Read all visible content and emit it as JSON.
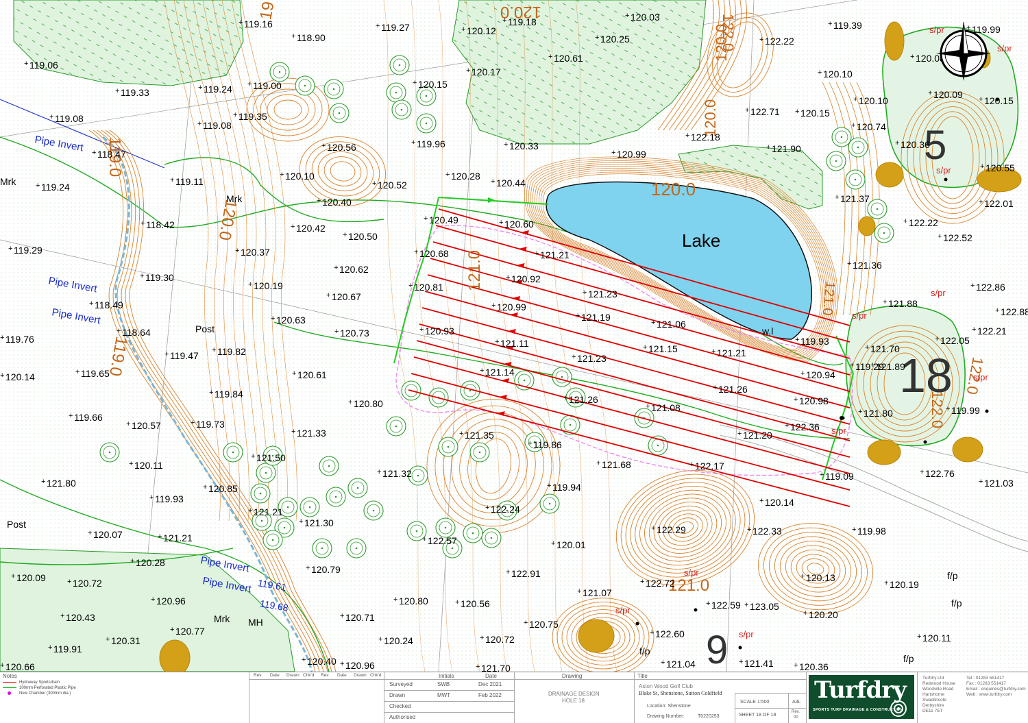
{
  "map": {
    "lake_label": "Lake",
    "hole_numbers": [
      "5",
      "18",
      "9"
    ],
    "contour_labels": [
      "120.0",
      "120.0",
      "120.0",
      "122.0",
      "122.0",
      "119.0",
      "119.0",
      "121.0",
      "121.0",
      "120.0",
      "121.0",
      "122.0",
      "19",
      "120.0"
    ],
    "pipe_inverts": [
      {
        "label": "Pipe Invert",
        "value": ""
      },
      {
        "label": "Pipe Invert",
        "value": ""
      },
      {
        "label": "Pipe Invert",
        "value": ""
      },
      {
        "label": "Pipe Invert",
        "value": "119.61"
      },
      {
        "label": "Pipe Invert",
        "value": "119.68"
      }
    ],
    "small_labels": [
      "Mrk",
      "Mrk",
      "Post",
      "Post",
      "Mrk",
      "MH",
      "w.l",
      "f/p",
      "f/p",
      "f/p",
      "f/p",
      "s/pr",
      "s/pr",
      "s/pr",
      "s/pr",
      "s/pr",
      "s/pr",
      "s/pr",
      "s/pr",
      "s/pr",
      "s/pr"
    ],
    "spot_heights": [
      "119.16",
      "118.90",
      "119.27",
      "120.12",
      "119.18",
      "120.03",
      "119.39",
      "119.99",
      "119.06",
      "119.33",
      "119.24",
      "119.00",
      "120.25",
      "120.61",
      "120.17",
      "122.22",
      "120.10",
      "120.08",
      "120.15",
      "120.10",
      "122.71",
      "120.15",
      "120.74",
      "120.09",
      "120.15",
      "119.08",
      "119.35",
      "119.08",
      "118.47",
      "120.56",
      "119.96",
      "120.33",
      "122.18",
      "121.90",
      "120.99",
      "120.36",
      "120.55",
      "119.24",
      "120.10",
      "119.11",
      "120.52",
      "120.28",
      "120.44",
      "121.37",
      "122.01",
      "120.40",
      "122.22",
      "122.52",
      "118.42",
      "120.42",
      "120.49",
      "120.60",
      "120.50",
      "120.68",
      "121.21",
      "119.29",
      "120.37",
      "120.62",
      "120.92",
      "121.36",
      "120.81",
      "119.30",
      "120.19",
      "121.23",
      "122.86",
      "120.67",
      "120.99",
      "121.88",
      "118.49",
      "121.19",
      "121.06",
      "122.88",
      "118.64",
      "120.63",
      "120.73",
      "119.93",
      "122.21",
      "119.76",
      "119.82",
      "120.93",
      "121.11",
      "121.15",
      "121.21",
      "122.05",
      "119.47",
      "121.70",
      "121.23",
      "121.89",
      "120.94",
      "120.14",
      "119.65",
      "120.61",
      "121.14",
      "121.26",
      "120.98",
      "121.80",
      "119.84",
      "120.80",
      "121.26",
      "121.08",
      "122.36",
      "119.99",
      "119.66",
      "119.73",
      "120.57",
      "121.33",
      "121.35",
      "121.20",
      "119.86",
      "120.11",
      "121.50",
      "121.68",
      "122.17",
      "122.76",
      "121.03",
      "121.80",
      "119.09",
      "120.85",
      "121.32",
      "119.94",
      "119.93",
      "121.21",
      "122.24",
      "120.14",
      "121.30",
      "122.57",
      "122.29",
      "122.33",
      "119.98",
      "120.07",
      "121.21",
      "120.01",
      "120.28",
      "120.79",
      "122.91",
      "120.13",
      "120.09",
      "120.72",
      "120.80",
      "120.56",
      "121.07",
      "122.72",
      "120.19",
      "120.96",
      "122.59",
      "123.05",
      "120.20",
      "120.43",
      "120.71",
      "120.75",
      "122.60",
      "120.11",
      "120.77",
      "120.24",
      "120.72",
      "120.31",
      "119.91",
      "120.40",
      "120.96",
      "121.04",
      "121.41",
      "120.36",
      "120.66",
      "121.70",
      "119.29"
    ]
  },
  "legend": {
    "notes_label": "Notes",
    "items": [
      {
        "label": "Hydraway Sportsdrain",
        "color": "#e00000"
      },
      {
        "label": "100mm Perforated Plastic Pipe",
        "color": "#00b400"
      },
      {
        "label": "New Chamber (300mm dia.)",
        "color": "#e000e0"
      }
    ]
  },
  "revisions": {
    "headers": [
      "Rev",
      "Date",
      "Drawn",
      "Chk'd"
    ]
  },
  "approvals": {
    "initials_header": "Initials",
    "date_header": "Date",
    "rows": [
      {
        "label": "Surveyed",
        "initials": "SWB",
        "date": "Dec 2021"
      },
      {
        "label": "Drawn",
        "initials": "MWT",
        "date": "Feb 2022"
      },
      {
        "label": "Checked",
        "initials": "",
        "date": ""
      },
      {
        "label": "Authorised",
        "initials": "",
        "date": ""
      }
    ]
  },
  "drawing": {
    "header": "Drawing",
    "name_line1": "DRAINAGE DESIGN",
    "name_line2": "HOLE 18"
  },
  "title": {
    "header": "Title",
    "line1": "Aston Wood Golf Club",
    "line2": "Blake St, Shenstone, Sutton Coldfield",
    "location": "Location: Shenstone",
    "drawing_number_label": "Drawing Number:",
    "drawing_number": "T0220253"
  },
  "scale": {
    "scale": "SCALE 1:500",
    "size": "A3L",
    "sheet": "SHEET 18 OF 18",
    "rev_label": "Rev.",
    "rev": "00"
  },
  "company": {
    "logo": "Turfdry",
    "tagline": "SPORTS TURF DRAINAGE & CONSTRUCTION",
    "address": [
      "Turfdry Ltd",
      "Redwood House",
      "Woodville Road",
      "Hartshorne",
      "Swadlincote",
      "Derbyshire",
      "DE11 7ET"
    ],
    "tel": "Tel : 01283 551417",
    "fax": "Fax : 01283 551417",
    "email": "Email : enquiries@turfdry.com",
    "web": "Web : www.turfdry.com"
  }
}
